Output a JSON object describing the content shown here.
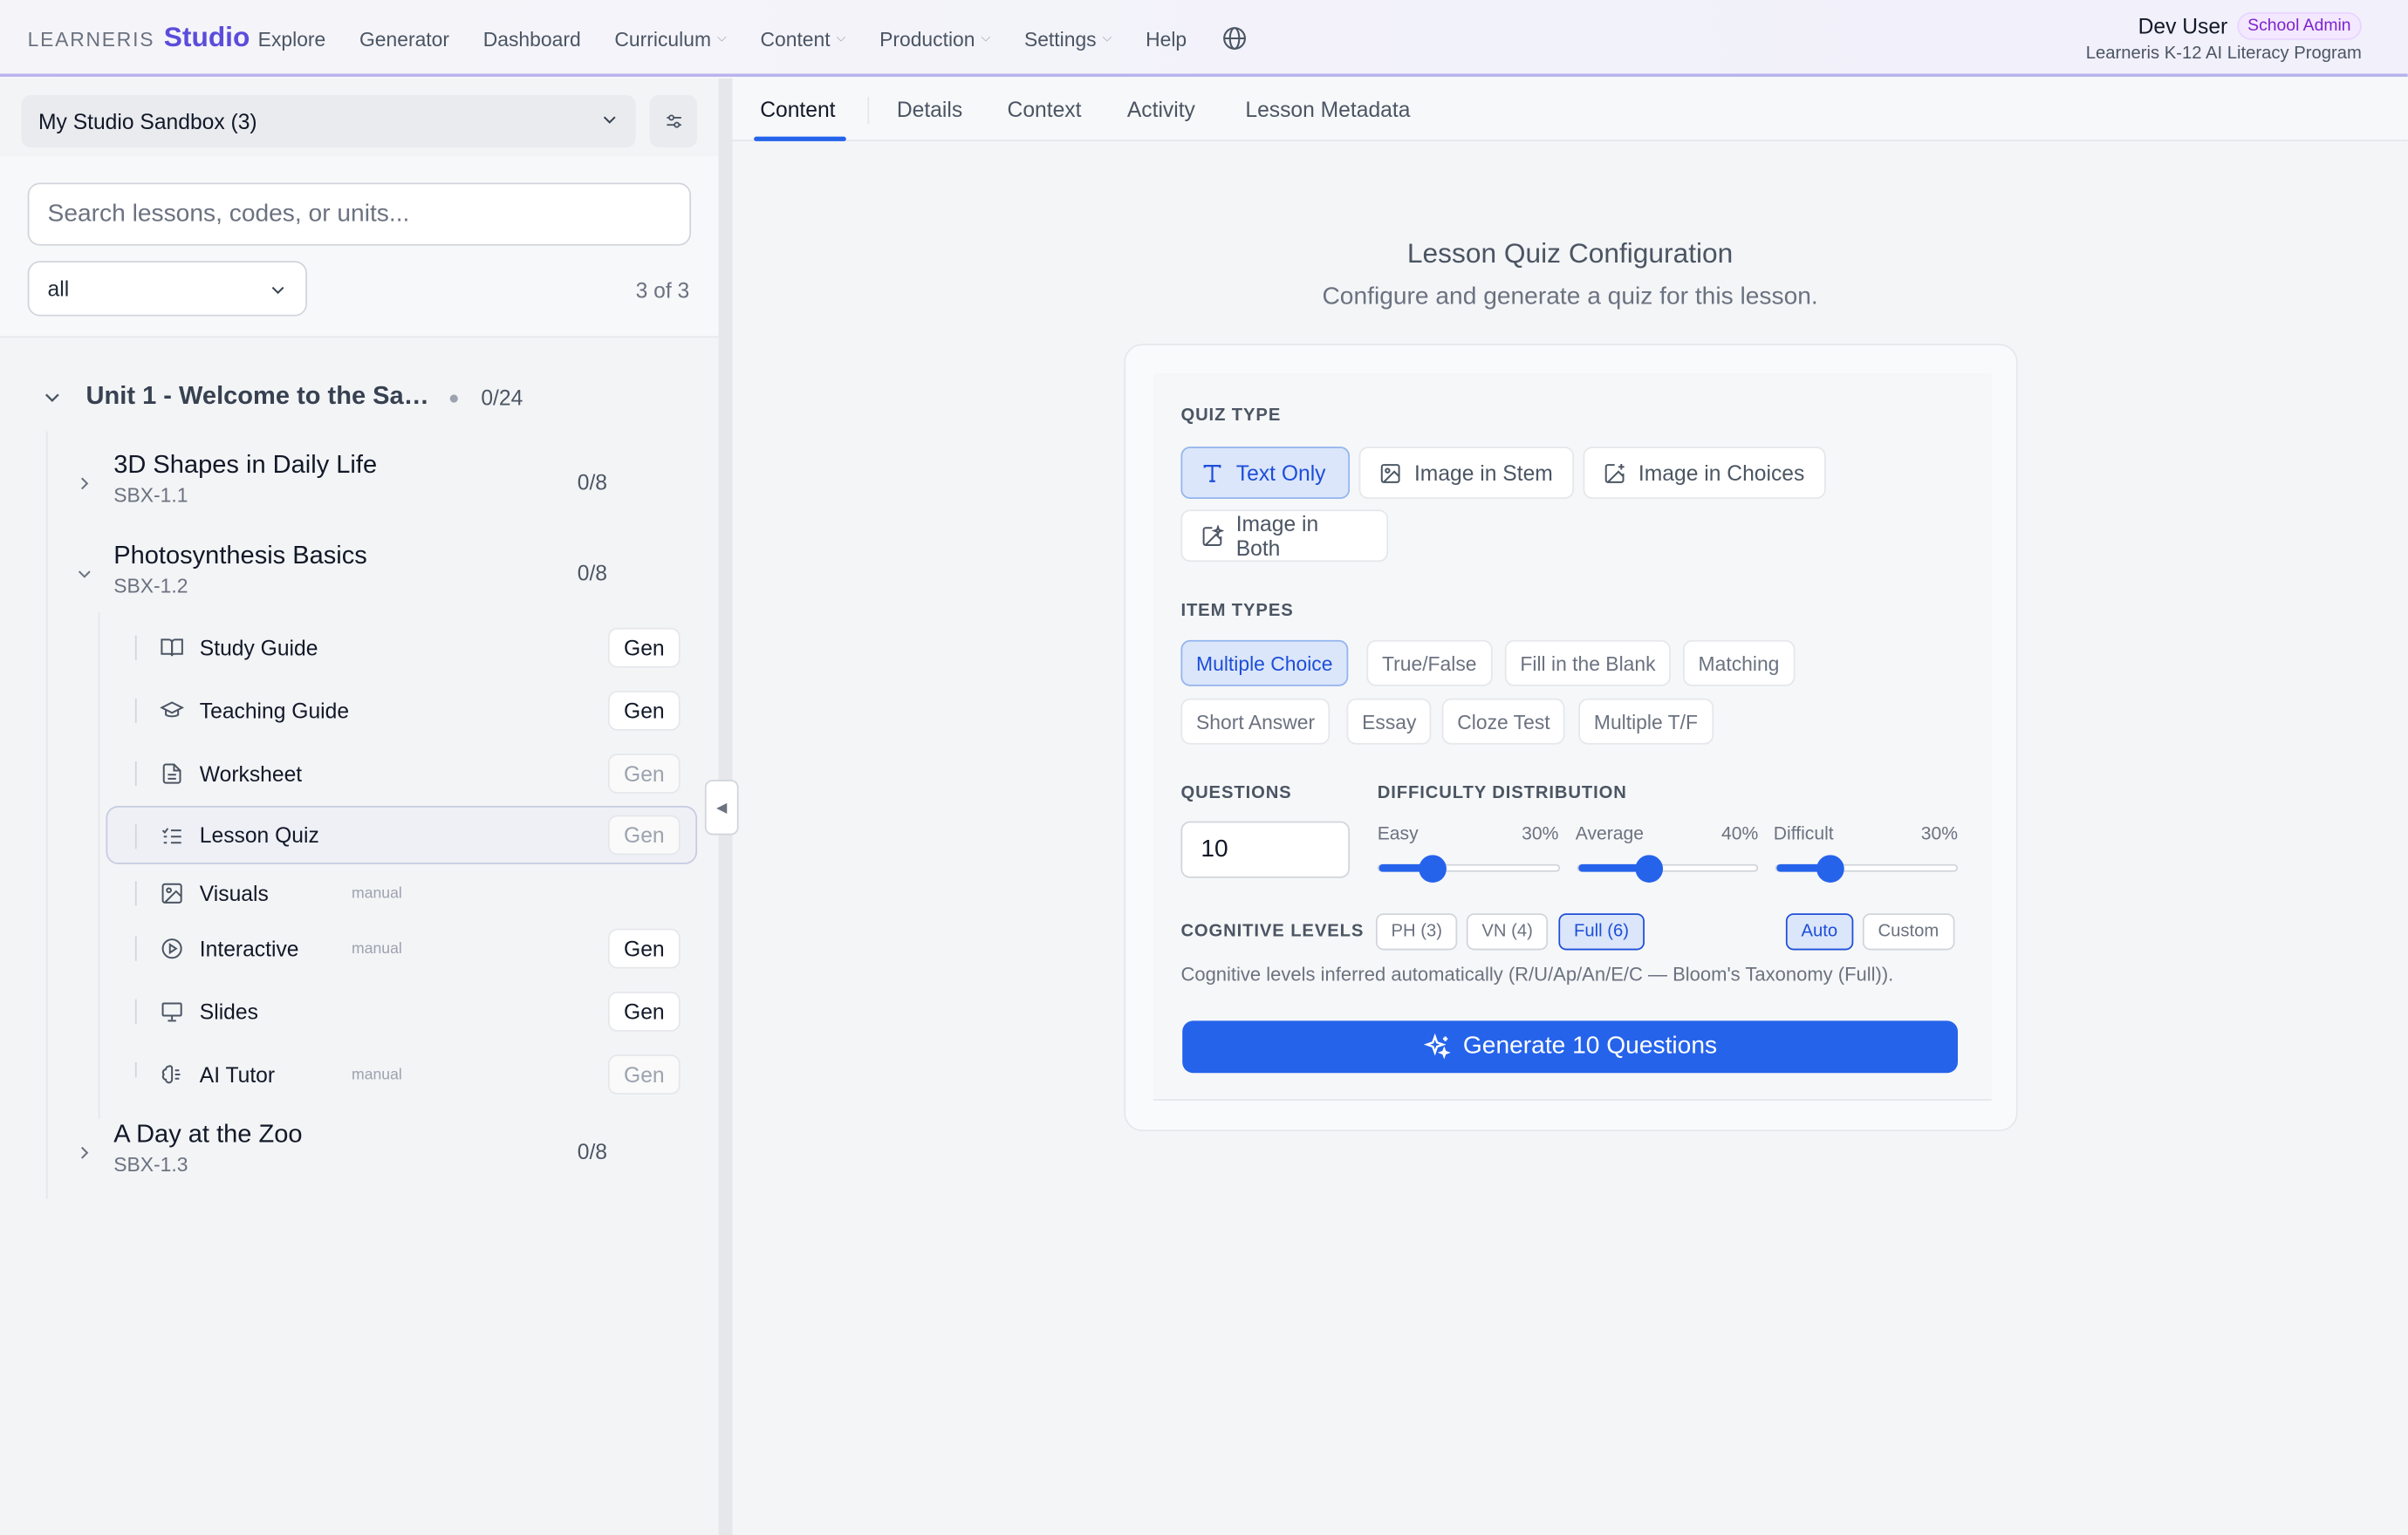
{
  "header": {
    "brand_small": "LEARNERIS",
    "brand_big": "Studio",
    "nav": [
      "Explore",
      "Generator",
      "Dashboard",
      "Curriculum",
      "Content",
      "Production",
      "Settings",
      "Help"
    ],
    "user_name": "Dev User",
    "role": "School Admin",
    "org": "Learneris K-12 AI Literacy Program"
  },
  "sidebar": {
    "sandbox_label": "My Studio Sandbox (3)",
    "search_placeholder": "Search lessons, codes, or units...",
    "status_filter": "all",
    "count": "3 of 3",
    "unit": {
      "title": "Unit 1 - Welcome to the San...",
      "progress": "0/24"
    },
    "lessons": [
      {
        "title": "3D Shapes in Daily Life",
        "code": "SBX-1.1",
        "progress": "0/8"
      },
      {
        "title": "Photosynthesis Basics",
        "code": "SBX-1.2",
        "progress": "0/8"
      },
      {
        "title": "A Day at the Zoo",
        "code": "SBX-1.3",
        "progress": "0/8"
      }
    ],
    "materials": [
      {
        "label": "Study Guide",
        "manual": "",
        "gen": "Gen"
      },
      {
        "label": "Teaching Guide",
        "manual": "",
        "gen": "Gen"
      },
      {
        "label": "Worksheet",
        "manual": "",
        "gen": "Gen"
      },
      {
        "label": "Lesson Quiz",
        "manual": "",
        "gen": "Gen"
      },
      {
        "label": "Visuals",
        "manual": "manual",
        "gen": ""
      },
      {
        "label": "Interactive",
        "manual": "manual",
        "gen": "Gen"
      },
      {
        "label": "Slides",
        "manual": "",
        "gen": "Gen"
      },
      {
        "label": "AI Tutor",
        "manual": "manual",
        "gen": "Gen"
      }
    ]
  },
  "tabs": [
    "Content",
    "Details",
    "Context",
    "Activity",
    "Lesson Metadata"
  ],
  "quiz": {
    "title": "Lesson Quiz Configuration",
    "subtitle": "Configure and generate a quiz for this lesson.",
    "quiz_type_label": "QUIZ TYPE",
    "quiz_types": [
      "Text Only",
      "Image in Stem",
      "Image in Choices",
      "Image in Both"
    ],
    "item_types_label": "ITEM TYPES",
    "item_types": [
      "Multiple Choice",
      "True/False",
      "Fill in the Blank",
      "Matching",
      "Short Answer",
      "Essay",
      "Cloze Test",
      "Multiple T/F"
    ],
    "questions_label": "QUESTIONS",
    "questions_value": "10",
    "difficulty_label": "DIFFICULTY DISTRIBUTION",
    "difficulty": [
      {
        "label": "Easy",
        "value_text": "30%",
        "value": 0.3
      },
      {
        "label": "Average",
        "value_text": "40%",
        "value": 0.4
      },
      {
        "label": "Difficult",
        "value_text": "30%",
        "value": 0.3
      }
    ],
    "cognitive_label": "COGNITIVE LEVELS",
    "cognitive_options": [
      "PH (3)",
      "VN (4)",
      "Full (6)"
    ],
    "mode_options": [
      "Auto",
      "Custom"
    ],
    "cognitive_note": "Cognitive levels inferred automatically (R/U/Ap/An/E/C — Bloom's Taxonomy (Full)).",
    "generate_label": "Generate 10 Questions"
  }
}
